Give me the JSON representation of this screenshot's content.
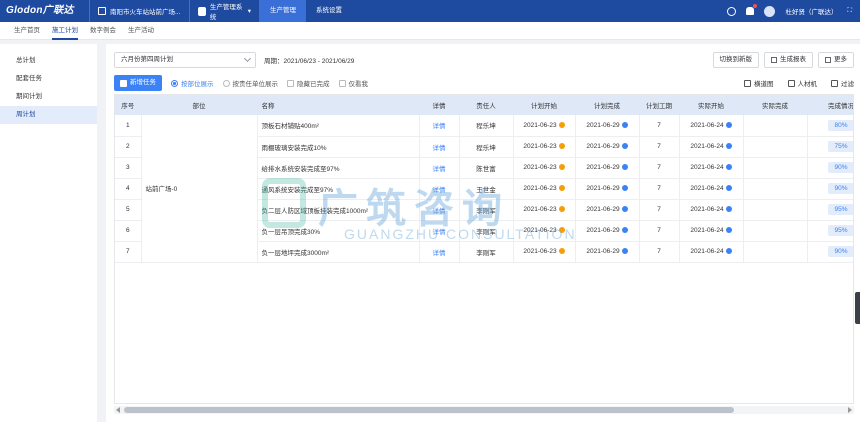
{
  "topbar": {
    "logo": "Glodon广联达",
    "project": "南阳市火车站站前广场...",
    "system": "生产管理系统",
    "nav": [
      "生产管理",
      "系统设置"
    ],
    "user": "杜好贤（广联达）"
  },
  "subtabs": [
    "生产首页",
    "施工计划",
    "数字例会",
    "生产活动"
  ],
  "leftmenu": [
    "总计划",
    "配套任务",
    "期间计划",
    "周计划"
  ],
  "filters": {
    "period_select": "六月份第四周计划",
    "period_text": "周期：2021/06/23 - 2021/06/29",
    "buttons": [
      "切换到新版",
      "生成报表",
      "更多"
    ]
  },
  "toolbar": {
    "new_task": "新增任务",
    "options": [
      "按部位展示",
      "按责任单位展示",
      "隐藏已完成",
      "仅看我"
    ],
    "tools": [
      "横道图",
      "人材机",
      "过滤"
    ]
  },
  "table": {
    "headers": [
      "序号",
      "部位",
      "名称",
      "详情",
      "责任人",
      "计划开始",
      "计划完成",
      "计划工期",
      "实际开始",
      "实际完成",
      "完成情况"
    ],
    "group": "站前广场-0",
    "rows": [
      {
        "no": "1",
        "name": "顶板石材铺贴400m²",
        "detail": "详情",
        "owner": "程乐坤",
        "plan_start": "2021-06-23",
        "plan_end": "2021-06-29",
        "duration": "7",
        "actual_start": "2021-06-24",
        "actual_end": "",
        "progress": "80%"
      },
      {
        "no": "2",
        "name": "雨棚玻璃安装完成10%",
        "detail": "详情",
        "owner": "程乐坤",
        "plan_start": "2021-06-23",
        "plan_end": "2021-06-29",
        "duration": "7",
        "actual_start": "2021-06-24",
        "actual_end": "",
        "progress": "75%"
      },
      {
        "no": "3",
        "name": "给排水系统安装完成至97%",
        "detail": "详情",
        "owner": "陈世富",
        "plan_start": "2021-06-23",
        "plan_end": "2021-06-29",
        "duration": "7",
        "actual_start": "2021-06-24",
        "actual_end": "",
        "progress": "90%"
      },
      {
        "no": "4",
        "name": "通风系统安装完成至97%",
        "detail": "详情",
        "owner": "王世金",
        "plan_start": "2021-06-23",
        "plan_end": "2021-06-29",
        "duration": "7",
        "actual_start": "2021-06-24",
        "actual_end": "",
        "progress": "90%"
      },
      {
        "no": "5",
        "name": "负二层人防区域顶板挂装完成1000m²",
        "detail": "详情",
        "owner": "李刚军",
        "plan_start": "2021-06-23",
        "plan_end": "2021-06-29",
        "duration": "7",
        "actual_start": "2021-06-24",
        "actual_end": "",
        "progress": "95%"
      },
      {
        "no": "6",
        "name": "负一层吊顶完成30%",
        "detail": "详情",
        "owner": "李刚军",
        "plan_start": "2021-06-23",
        "plan_end": "2021-06-29",
        "duration": "7",
        "actual_start": "2021-06-24",
        "actual_end": "",
        "progress": "95%"
      },
      {
        "no": "7",
        "name": "负一层地坪完成3000m²",
        "detail": "详情",
        "owner": "李刚军",
        "plan_start": "2021-06-23",
        "plan_end": "2021-06-29",
        "duration": "7",
        "actual_start": "2021-06-24",
        "actual_end": "",
        "progress": "90%"
      }
    ]
  },
  "watermark": {
    "cn": "广筑咨询",
    "en": "GUANGZHU CONSULTATION"
  },
  "colors": {
    "topbar": "#1e4aa0",
    "primary": "#3b82f6",
    "header_bg": "#dfe8f7",
    "warn": "#f59e0b"
  }
}
